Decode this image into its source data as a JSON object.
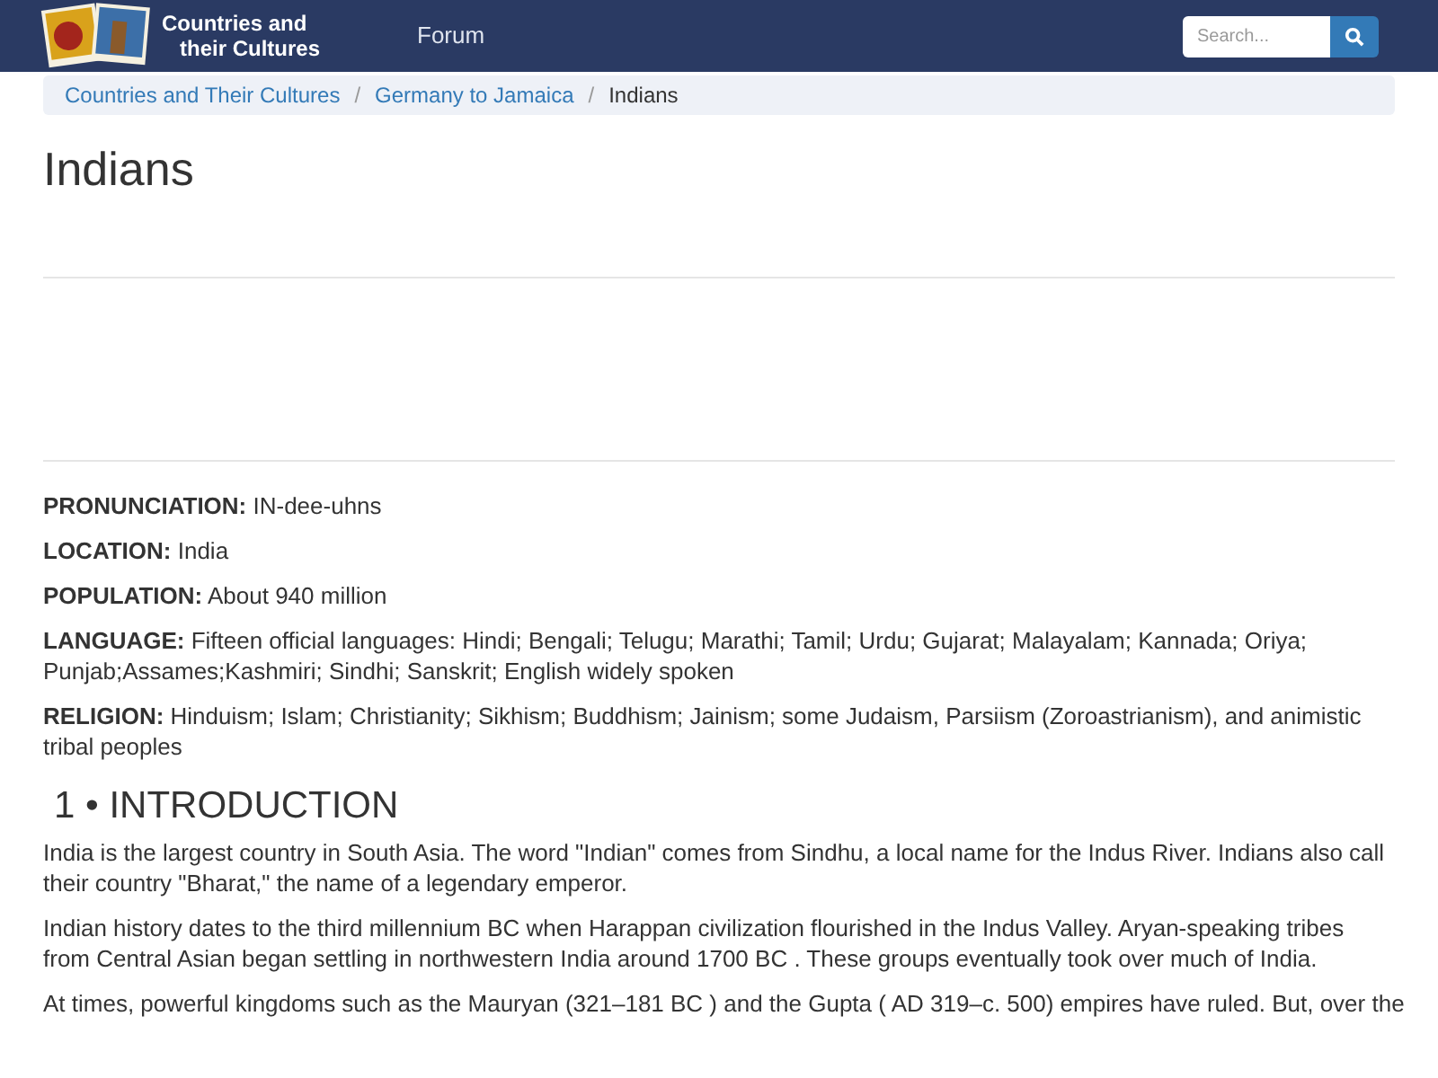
{
  "header": {
    "logo_text_1": "Countries and",
    "logo_text_2": "their Cultures",
    "nav": [
      "Forum"
    ],
    "search": {
      "placeholder": "Search..."
    }
  },
  "breadcrumb": {
    "separator": "/",
    "items": [
      {
        "label": "Countries and Their Cultures",
        "link": true
      },
      {
        "label": "Germany to Jamaica",
        "link": true
      },
      {
        "label": "Indians",
        "link": false
      }
    ]
  },
  "title": "Indians",
  "facts": [
    "**PRONUNCIATION:** IN-dee-uhns",
    "**LOCATION:** India",
    "**POPULATION:** About 940 million",
    "**LANGUAGE:** Fifteen official languages: Hindi; Bengali; Telugu; Marathi; Tamil; Urdu; Gujarat; Malayalam; Kannada; Oriya; Punjab;Assames;Kashmiri; Sindhi; Sanskrit; English widely spoken",
    "**RELIGION:** Hinduism; Islam; Christianity; Sikhism; Buddhism; Jainism; some Judaism, Parsiism (Zoroastrianism), and animistic tribal peoples"
  ],
  "section": {
    "heading": "1 • INTRODUCTION",
    "paragraphs": [
      "India is the largest country in South Asia. The word \"Indian\" comes from Sindhu, a local name for the Indus River. Indians also call their country \"Bharat,\" the name of a legendary emperor.",
      "Indian history dates to the third millennium BC when Harappan civilization flourished in the Indus Valley. Aryan-speaking tribes from Central Asian began settling in northwestern India around 1700 BC . These groups eventually took over much of India.",
      "At times, powerful kingdoms such as the Mauryan (321–181 BC ) and the Gupta ( AD 319–c. 500) empires have ruled. But, over the"
    ]
  }
}
